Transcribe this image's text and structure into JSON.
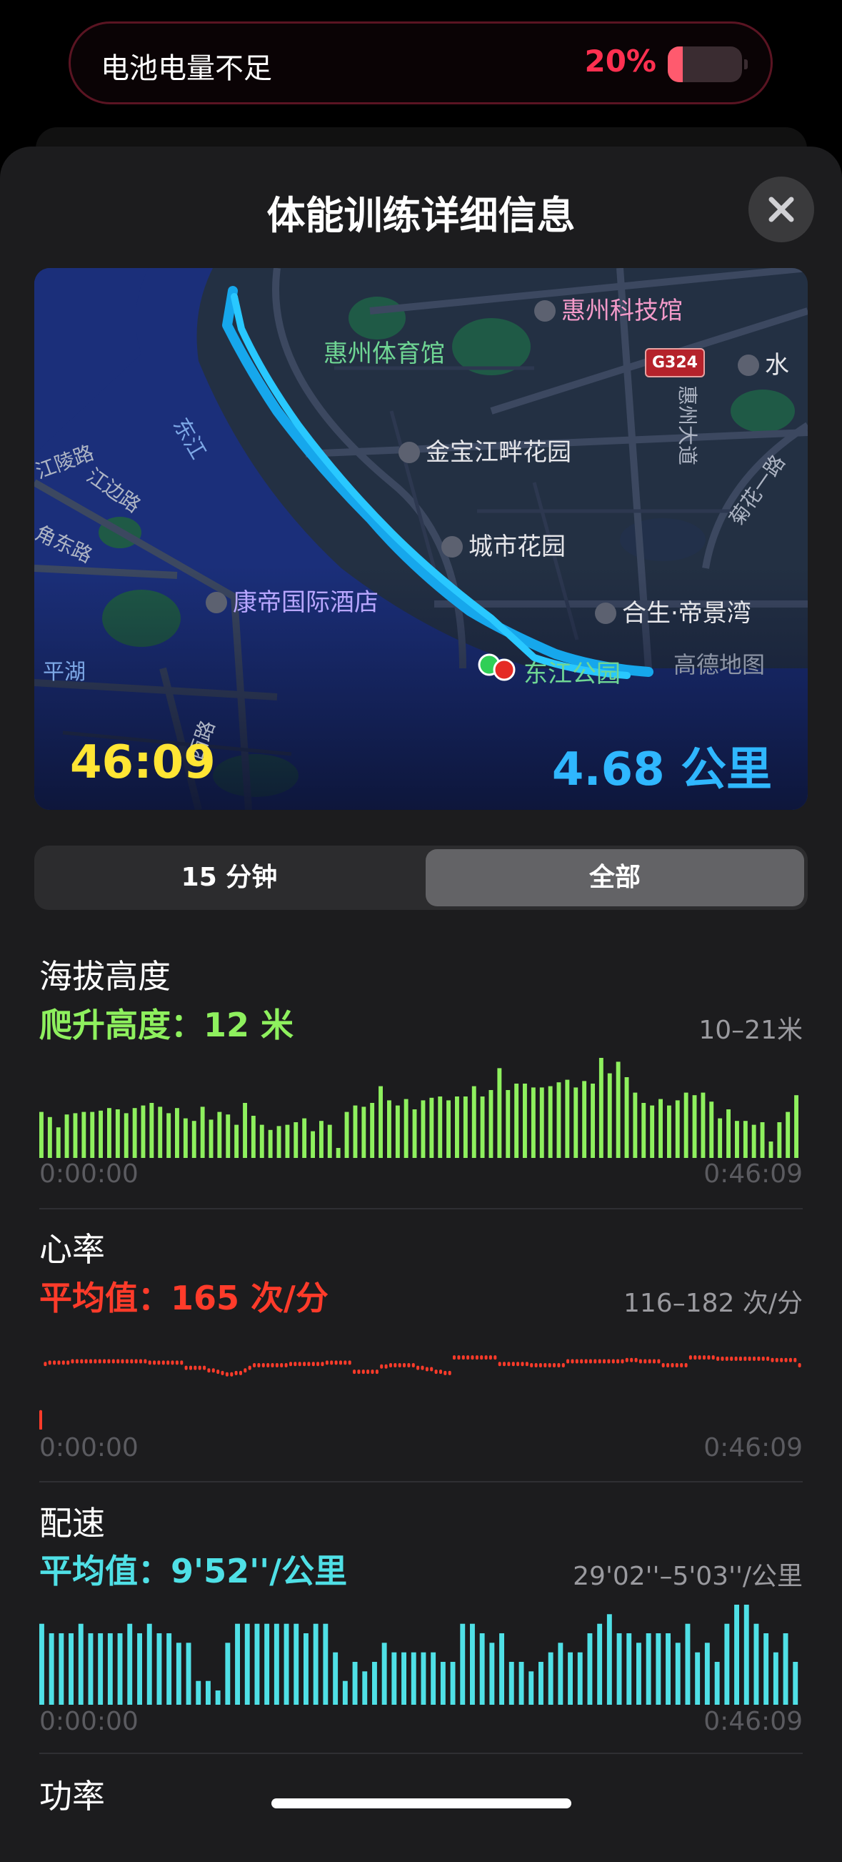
{
  "banner": {
    "label": "电池电量不足",
    "percent": "20%",
    "battery_level": 0.2
  },
  "sheet": {
    "title": "体能训练详细信息"
  },
  "map": {
    "labels": {
      "museum": "惠州科技馆",
      "stadium": "惠州体育馆",
      "shield": "G324",
      "water": "水",
      "jinbao": "金宝江畔花园",
      "city_garden": "城市花园",
      "hesheng": "合生·帝景湾",
      "hotel": "康帝国际酒店",
      "river": "东江",
      "park": "东江公园",
      "pinghu": "平湖",
      "amap": "高德地图",
      "road_huizhou": "惠州大道",
      "road_juhua": "菊花一路",
      "road_jiangling": "江陵路",
      "road_jiangbian": "江边路",
      "road_jiaodong": "角东路",
      "road_xi": "西路"
    },
    "duration": "46:09",
    "distance": "4.68 公里"
  },
  "segmented": {
    "left": "15 分钟",
    "right": "全部",
    "selected": "全部"
  },
  "altitude": {
    "title": "海拔高度",
    "subtitle": "爬升高度：12 米",
    "range": "10–21米",
    "start": "0:00:00",
    "end": "0:46:09",
    "color": "#8ef05e"
  },
  "heart_rate": {
    "title": "心率",
    "subtitle": "平均值：165 次/分",
    "range": "116–182 次/分",
    "start": "0:00:00",
    "end": "0:46:09",
    "color": "#ff3b2a"
  },
  "pace": {
    "title": "配速",
    "subtitle": "平均值：9'52''/公里",
    "range": "29'02''–5'03''/公里",
    "start": "0:00:00",
    "end": "0:46:09",
    "color": "#4fe0e6"
  },
  "power": {
    "title": "功率"
  },
  "chart_data": [
    {
      "type": "bar",
      "title": "海拔高度",
      "ylabel": "米",
      "ylim": [
        10,
        21
      ],
      "xlim": [
        "0:00:00",
        "0:46:09"
      ],
      "values": [
        14.6,
        14.2,
        13.4,
        14.4,
        14.5,
        14.6,
        14.6,
        14.7,
        14.9,
        14.8,
        14.5,
        14.9,
        15.1,
        15.3,
        15.0,
        14.5,
        14.9,
        14.1,
        13.9,
        15.0,
        14.0,
        14.6,
        14.4,
        13.6,
        15.3,
        14.3,
        13.6,
        13.2,
        13.5,
        13.6,
        13.8,
        14.1,
        13.1,
        13.9,
        13.6,
        11.8,
        14.6,
        15.1,
        15.0,
        15.3,
        16.6,
        15.5,
        15.1,
        15.6,
        14.8,
        15.5,
        15.7,
        15.8,
        15.5,
        15.8,
        15.8,
        16.6,
        15.8,
        16.3,
        18.0,
        16.3,
        16.8,
        16.8,
        16.5,
        16.5,
        16.6,
        16.9,
        17.1,
        16.5,
        17.0,
        16.8,
        18.8,
        17.6,
        18.5,
        17.3,
        16.1,
        15.3,
        15.1,
        15.6,
        15.1,
        15.5,
        16.1,
        15.9,
        16.1,
        15.4,
        14.1,
        14.8,
        13.9,
        13.9,
        13.6,
        13.8,
        12.3,
        13.8,
        14.6,
        15.9
      ]
    },
    {
      "type": "scatter",
      "title": "心率",
      "ylabel": "次/分",
      "ylim": [
        116,
        182
      ],
      "xlim": [
        "0:00:00",
        "0:46:09"
      ],
      "values": [
        120,
        161,
        162,
        162,
        162,
        162,
        162,
        163,
        163,
        163,
        163,
        163,
        163,
        163,
        163,
        163,
        163,
        163,
        163,
        163,
        163,
        163,
        163,
        163,
        162,
        162,
        162,
        162,
        162,
        162,
        162,
        162,
        158,
        158,
        158,
        158,
        158,
        156,
        156,
        155,
        154,
        153,
        153,
        154,
        154,
        156,
        158,
        160,
        160,
        160,
        160,
        160,
        160,
        160,
        160,
        161,
        161,
        161,
        161,
        161,
        161,
        161,
        161,
        162,
        162,
        162,
        162,
        162,
        162,
        155,
        155,
        155,
        155,
        155,
        155,
        159,
        159,
        160,
        160,
        160,
        160,
        160,
        160,
        158,
        158,
        157,
        157,
        155,
        155,
        154,
        154,
        166,
        166,
        166,
        166,
        166,
        166,
        166,
        166,
        166,
        166,
        161,
        161,
        161,
        161,
        161,
        161,
        161,
        160,
        160,
        160,
        160,
        160,
        160,
        160,
        160,
        163,
        163,
        163,
        163,
        163,
        163,
        163,
        163,
        163,
        163,
        163,
        163,
        163,
        164,
        164,
        164,
        163,
        163,
        163,
        163,
        163,
        160,
        160,
        160,
        160,
        160,
        160,
        166,
        166,
        166,
        166,
        166,
        166,
        165,
        165,
        165,
        165,
        165,
        165,
        165,
        165,
        165,
        165,
        165,
        165,
        164,
        164,
        164,
        164,
        164,
        164,
        160
      ]
    },
    {
      "type": "bar",
      "title": "配速",
      "ylabel": "/公里",
      "ylim": [
        "29'02''",
        "5'03''"
      ],
      "xlim": [
        "0:00:00",
        "0:46:09"
      ],
      "values": [
        12,
        11,
        11,
        11,
        12,
        11,
        11,
        11,
        11,
        12,
        11,
        12,
        11,
        11,
        10,
        10,
        6,
        6,
        5,
        10,
        12,
        12,
        12,
        12,
        12,
        12,
        12,
        11,
        12,
        12,
        9,
        6,
        8,
        7,
        8,
        10,
        9,
        9,
        9,
        9,
        9,
        8,
        8,
        12,
        12,
        11,
        10,
        11,
        8,
        8,
        7,
        8,
        9,
        10,
        9,
        9,
        11,
        12,
        13,
        11,
        11,
        10,
        11,
        11,
        11,
        10,
        12,
        9,
        10,
        8,
        12,
        14,
        14,
        12,
        11,
        9,
        11,
        8
      ]
    }
  ]
}
